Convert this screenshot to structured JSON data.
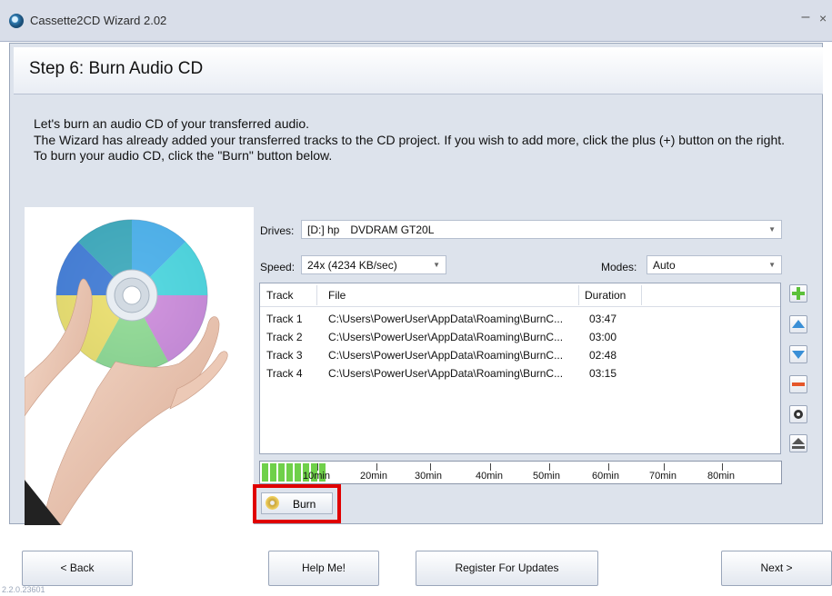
{
  "window": {
    "title": "Cassette2CD Wizard 2.02",
    "minimize_glyph": "–",
    "close_glyph": "×"
  },
  "step": {
    "title": "Step 6: Burn Audio CD"
  },
  "instructions": [
    "Let's burn an audio CD of your transferred audio.",
    "The Wizard has already added your transferred tracks to the CD project. If you wish to add more, click the plus (+) button on the right.",
    "To burn your audio CD, click the \"Burn\" button below."
  ],
  "drives": {
    "label": "Drives:",
    "value_drive": "[D:] hp",
    "value_name": "DVDRAM GT20L"
  },
  "speed": {
    "label": "Speed:",
    "value": "24x (4234 KB/sec)"
  },
  "modes": {
    "label": "Modes:",
    "value": "Auto"
  },
  "track_list": {
    "headers": {
      "track": "Track",
      "file": "File",
      "duration": "Duration"
    },
    "rows": [
      {
        "track": "Track 1",
        "file": "C:\\Users\\PowerUser\\AppData\\Roaming\\BurnC...",
        "duration": "03:47"
      },
      {
        "track": "Track 2",
        "file": "C:\\Users\\PowerUser\\AppData\\Roaming\\BurnC...",
        "duration": "03:00"
      },
      {
        "track": "Track 3",
        "file": "C:\\Users\\PowerUser\\AppData\\Roaming\\BurnC...",
        "duration": "02:48"
      },
      {
        "track": "Track 4",
        "file": "C:\\Users\\PowerUser\\AppData\\Roaming\\BurnC...",
        "duration": "03:15"
      }
    ]
  },
  "side_buttons": [
    {
      "icon": "add-icon",
      "color": "#5cc13a"
    },
    {
      "icon": "move-up-icon",
      "color": "#3a8fd6"
    },
    {
      "icon": "move-down-icon",
      "color": "#3a8fd6"
    },
    {
      "icon": "remove-icon",
      "color": "#e5572a"
    },
    {
      "icon": "disc-icon",
      "color": "#333333"
    },
    {
      "icon": "eject-icon",
      "color": "#555555"
    }
  ],
  "timeline": {
    "labels": [
      "10min",
      "20min",
      "30min",
      "40min",
      "50min",
      "60min",
      "70min",
      "80min"
    ],
    "fill_color": "#6fd04a"
  },
  "burn_button": {
    "label": "Burn",
    "highlight_color": "#e00000"
  },
  "nav": {
    "back": "< Back",
    "help": "Help Me!",
    "register": "Register For Updates",
    "next": "Next >"
  },
  "version": "2.2.0.23601"
}
